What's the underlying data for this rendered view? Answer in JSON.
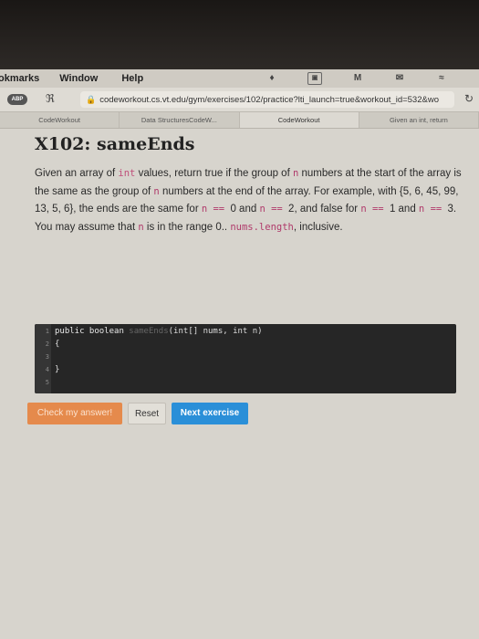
{
  "menubar": {
    "items": [
      "okmarks",
      "Window",
      "Help"
    ]
  },
  "browser": {
    "url": "codeworkout.cs.vt.edu/gym/exercises/102/practice?lti_launch=true&workout_id=532&wo",
    "tabs": [
      "CodeWorkout",
      "Data StructuresCodeW...",
      "CodeWorkout",
      "Given an int, return"
    ]
  },
  "exercise": {
    "title": "X102: sameEnds",
    "desc": {
      "s1": "Given an array of ",
      "c1": "int",
      "s2": " values, return true if the group of ",
      "c2": "n",
      "s3": " numbers at the start of the array is the same as the group of ",
      "c3": "n",
      "s4": " numbers at the end of the array. For example, with {5, 6, 45, 99, 13, 5, 6}, the ends are the same for ",
      "c4": "n == ",
      "s5": "0 and ",
      "c5": "n == ",
      "s6": "2, and false for ",
      "c6": "n == ",
      "s7": "1 and ",
      "c7": "n == ",
      "s8": "3. You may assume that ",
      "c8": "n",
      "s9": " is in the range 0.. ",
      "c9": "nums.length",
      "s10": ", inclusive."
    }
  },
  "editor": {
    "line_numbers": [
      "1",
      "2",
      "3",
      "4",
      "5"
    ],
    "line1_kw": "public boolean ",
    "line1_fn": "sameEnds",
    "line1_rest": "(int[] nums, int n)",
    "line2": "{",
    "line4": "}"
  },
  "buttons": {
    "check": "Check my answer!",
    "reset": "Reset",
    "next": "Next exercise"
  }
}
